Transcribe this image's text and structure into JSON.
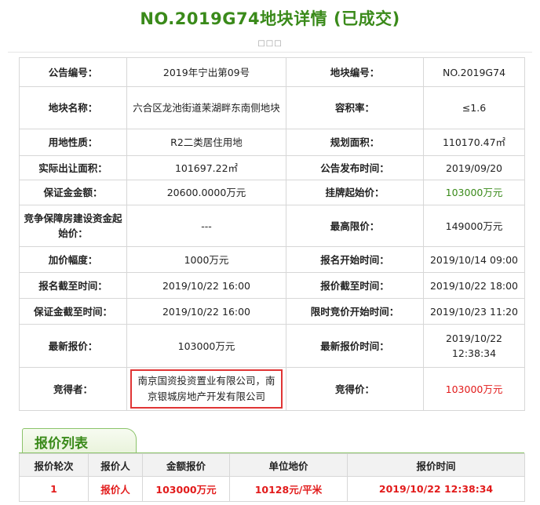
{
  "page": {
    "title": "NO.2019G74地块详情 (已成交)",
    "dots": "□□□"
  },
  "detail": {
    "announce_no_label": "公告编号：",
    "announce_no": "2019年宁出第09号",
    "parcel_no_label": "地块编号：",
    "parcel_no": "NO.2019G74",
    "parcel_name_label": "地块名称：",
    "parcel_name": "六合区龙池街道茉湖畔东南侧地块",
    "plot_ratio_label": "容积率：",
    "plot_ratio": "≤1.6",
    "land_use_label": "用地性质：",
    "land_use": "R2二类居住用地",
    "planned_area_label": "规划面积：",
    "planned_area": "110170.47㎡",
    "actual_area_label": "实际出让面积：",
    "actual_area": "101697.22㎡",
    "announce_time_label": "公告发布时间：",
    "announce_time": "2019/09/20",
    "deposit_label": "保证金金额：",
    "deposit": "20600.0000万元",
    "start_price_label": "挂牌起始价：",
    "start_price": "103000万元",
    "housing_label": "竞争保障房建设资金起始价：",
    "housing_value": "---",
    "max_price_label": "最高限价：",
    "max_price": "149000万元",
    "increment_label": "加价幅度：",
    "increment": "1000万元",
    "signup_start_label": "报名开始时间：",
    "signup_start": "2019/10/14 09:00",
    "signup_end_label": "报名截至时间：",
    "signup_end": "2019/10/22 16:00",
    "bid_end_label": "报价截至时间：",
    "bid_end": "2019/10/22 18:00",
    "deposit_end_label": "保证金截至时间：",
    "deposit_end": "2019/10/22 16:00",
    "limit_bid_start_label": "限时竞价开始时间：",
    "limit_bid_start": "2019/10/23 11:20",
    "latest_bid_label": "最新报价：",
    "latest_bid": "103000万元",
    "latest_bid_time_label": "最新报价时间：",
    "latest_bid_time": "2019/10/22 12:38:34",
    "winner_label": "竞得者：",
    "winner": "南京国资投资置业有限公司，南京银城房地产开发有限公司",
    "winning_price_label": "竞得价：",
    "winning_price": "103000万元"
  },
  "bids": {
    "tab_label": "报价列表",
    "headers": [
      "报价轮次",
      "报价人",
      "金额报价",
      "单位地价",
      "报价时间"
    ],
    "rows": [
      [
        "1",
        "报价人",
        "103000万元",
        "10128元/平米",
        "2019/10/22 12:38:34"
      ]
    ]
  },
  "colors": {
    "title_green": "#3a8a1a",
    "price_red": "#e21b1b",
    "border": "#d7d7d7",
    "highlight_box": "#e03535"
  }
}
